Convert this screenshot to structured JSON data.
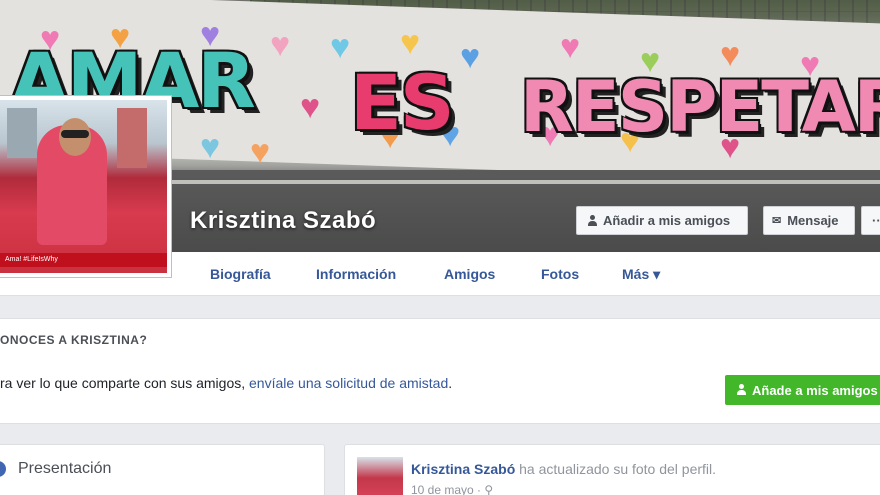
{
  "cover": {
    "graffiti_words": [
      "AMAR",
      "ES",
      "RESPETAR"
    ]
  },
  "profile": {
    "name": "Krisztina Szabó",
    "photo_banner": "Ama!  #LifeIsWhy"
  },
  "cover_actions": {
    "add_friend": "Añadir a mis amigos",
    "message": "Mensaje",
    "more": "···"
  },
  "nav": {
    "tabs": [
      "Biografía",
      "Información",
      "Amigos",
      "Fotos",
      "Más ▾"
    ]
  },
  "know_box": {
    "title": "ONOCES A KRISZTINA?",
    "text_prefix": "ra ver lo que comparte con sus amigos, ",
    "link": "envíale una solicitud de amistad",
    "text_suffix": ".",
    "button": "Añade a mis amigos"
  },
  "intro": {
    "title": "Presentación"
  },
  "post": {
    "author": "Krisztina Szabó",
    "action": " ha actualizado su foto del perfil.",
    "date": "10 de mayo · ⚲"
  },
  "colors": {
    "link": "#365899",
    "green": "#42b72a",
    "page_bg": "#e9ebee"
  }
}
